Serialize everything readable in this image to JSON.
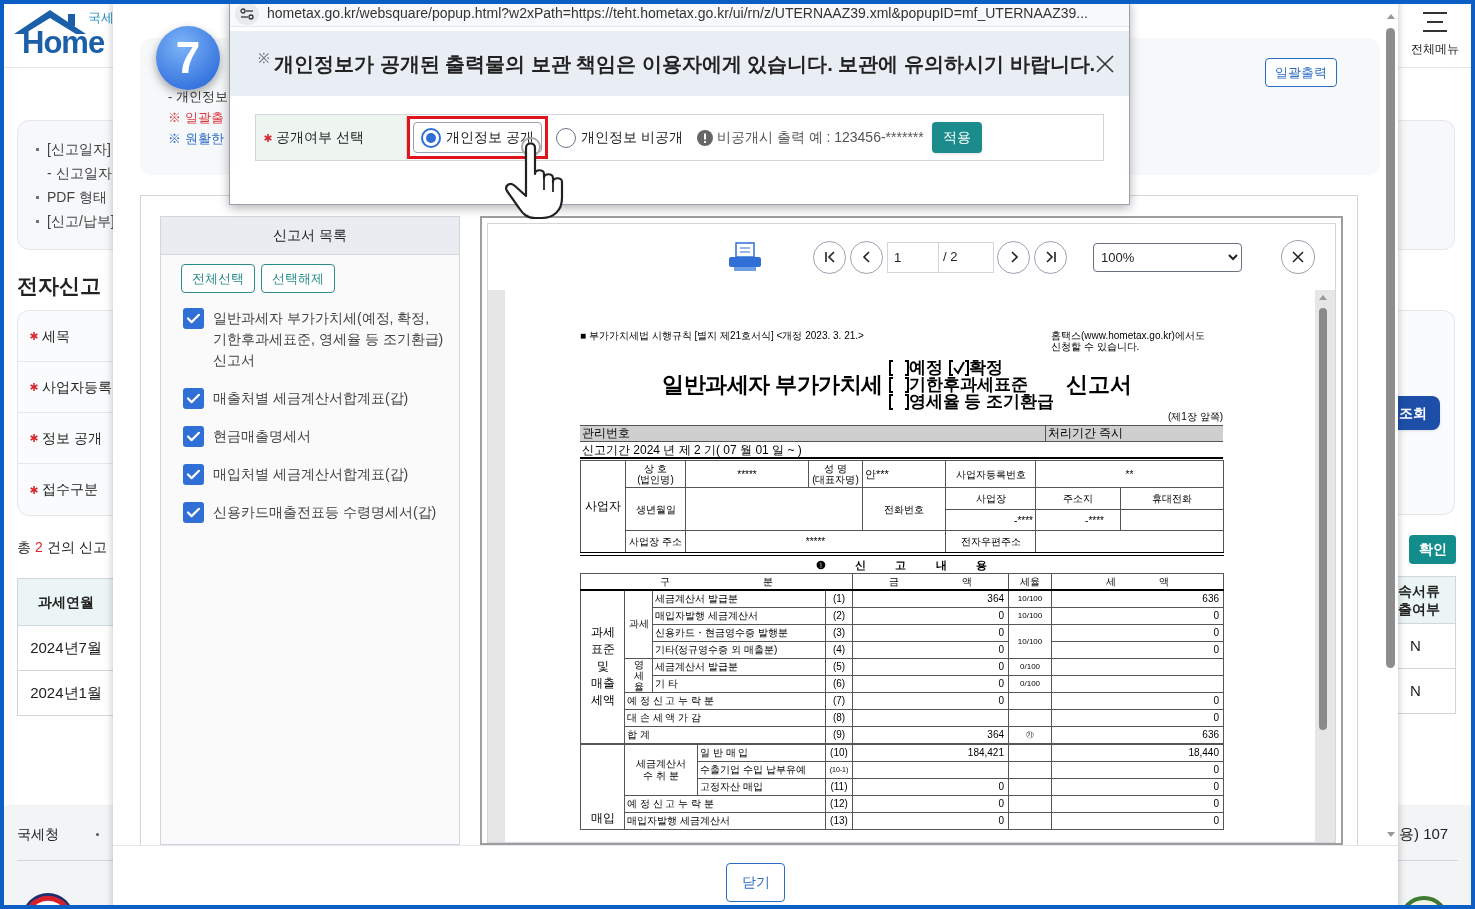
{
  "page": {
    "logo": {
      "label": "국세",
      "wordmark": "Home"
    },
    "menu_label": "전체메뉴",
    "guide_lines": [
      {
        "text": "[신고일자]",
        "bullet": true
      },
      {
        "text": "- 신고일자",
        "bullet": false
      },
      {
        "text": "PDF 형태",
        "bullet": true
      },
      {
        "text": "[신고/납부]",
        "bullet": true
      }
    ],
    "section_title": "전자신고",
    "search_fields": [
      {
        "label": "세목",
        "required": true
      },
      {
        "label": "사업자등록",
        "required": true
      },
      {
        "label": "정보 공개",
        "required": true
      },
      {
        "label": "접수구분",
        "required": true
      }
    ],
    "search_button": "조회",
    "result_count": {
      "prefix": "총",
      "count": "2",
      "suffix": "건의 신고"
    },
    "confirm_button": "확인",
    "table": {
      "column_1": "과세연월",
      "column_2": "속서류\n출여부",
      "rows": [
        {
          "column_1": "2024년7월",
          "column_2": "N"
        },
        {
          "column_1": "2024년1월",
          "column_2": "N"
        }
      ]
    },
    "footer": {
      "left": "국세청",
      "right": "용) 107"
    }
  },
  "modal": {
    "step_badge": "7",
    "notes": [
      {
        "text": "- 개인정보",
        "color": "#333333"
      },
      {
        "text": "※ 일괄출",
        "color": "#d9363e"
      },
      {
        "text": "※ 원활한",
        "color": "#2b6cc4"
      }
    ],
    "bulk_print_button": "일괄출력",
    "report_list": {
      "title": "신고서 목록",
      "buttons": [
        "전체선택",
        "선택해제"
      ],
      "items": [
        {
          "label": "일반과세자 부가가치세(예정, 확정, 기한후과세표준, 영세율 등 조기환급)신고서",
          "checked": true
        },
        {
          "label": "매출처별 세금계산서합계표(갑)",
          "checked": true
        },
        {
          "label": "현금매출명세서",
          "checked": true
        },
        {
          "label": "매입처별 세금계산서합계표(갑)",
          "checked": true
        },
        {
          "label": "신용카드매출전표등 수령명세서(갑)",
          "checked": true
        }
      ]
    },
    "viewer": {
      "page": "1",
      "page_total": "/ 2",
      "zoom": "100%",
      "document": {
        "form_note": "■ 부가가치세법 시행규칙 [별지 제21호서식] <개정 2023. 3. 21.>",
        "online_note": "홈택스(www.hometax.go.kr)에서도\n신청할 수 있습니다.",
        "title": "일반과세자 부가가치세",
        "title_options": [
          [
            {
              "label": "예정",
              "checked": false
            },
            {
              "label": "확정",
              "checked": true
            }
          ],
          [
            {
              "label": "기한후과세표준",
              "checked": false
            }
          ],
          [
            {
              "label": "영세율 등 조기환급",
              "checked": false
            }
          ]
        ],
        "title_suffix": "신고서",
        "page_note": "(제1장 앞쪽)",
        "management_label": "관리번호",
        "processing": "처리기간 즉시",
        "period": "신고기간 2024 년 제 2 기( 07 월 01 일 ~ )",
        "business": {
          "label": "사업자",
          "trade_name_label": "상 호\n(법인명)",
          "trade_name": "*****",
          "representative_label": "성 명\n(대표자명)",
          "representative": "안***",
          "registration_label": "사업자등록번호",
          "registration_number": "**",
          "birth_label": "생년월일",
          "phone_label": "전화번호",
          "phone_columns": [
            "사업장",
            "주소지",
            "휴대전화"
          ],
          "phones": [
            "-****",
            "-****"
          ],
          "address_label": "사업장 주소",
          "address": "*****",
          "email_label": "전자우편주소"
        },
        "section_heading": "❶ 신 고 내 용",
        "columns": [
          "구 분",
          "금 액",
          "세율",
          "세 액"
        ],
        "sections": [
          {
            "lines": [
              "과세",
              "표준",
              "및",
              "매출",
              "세액"
            ],
            "groups": [
              {
                "label": "과세",
                "vertical": false,
                "rows": [
                  {
                    "item": "세금계산서 발급분",
                    "no": "(1)",
                    "amount": "364",
                    "rate": "10/100",
                    "tax": "636"
                  },
                  {
                    "item": "매입자발행 세금계산서",
                    "no": "(2)",
                    "amount": "0",
                    "rate": "10/100",
                    "tax": "0"
                  },
                  {
                    "item": "신용카드・현금영수증 발행분",
                    "no": "(3)",
                    "amount": "0",
                    "rate": "10/100",
                    "tax": "0"
                  },
                  {
                    "item": "기타(정규영수증 외 매출분)",
                    "no": "(4)",
                    "amount": "0",
                    "rate_merged": true,
                    "tax": "0"
                  }
                ]
              },
              {
                "label": "영세율",
                "vertical": true,
                "rows": [
                  {
                    "item": "세금계산서 발급분",
                    "no": "(5)",
                    "amount": "0",
                    "rate": "0/100"
                  },
                  {
                    "item": "기 타",
                    "no": "(6)",
                    "amount": "0",
                    "rate": "0/100"
                  }
                ]
              },
              {
                "rows": [
                  {
                    "item": "예 정 신 고 누 락 분",
                    "no": "(7)",
                    "amount": "0",
                    "tax": "0"
                  },
                  {
                    "item": "대 손 세 액 가 감",
                    "no": "(8)",
                    "tax": "0"
                  },
                  {
                    "item": "합 계",
                    "no": "(9)",
                    "amount": "364",
                    "rate": "㉮",
                    "tax": "636"
                  }
                ]
              }
            ]
          },
          {
            "lines": [
              "매입"
            ],
            "groups": [
              {
                "label": "세금계산서\n수 취 분",
                "vertical": false,
                "rows": [
                  {
                    "item": "일 반 매 입",
                    "no": "(10)",
                    "amount": "184,421",
                    "tax": "18,440"
                  },
                  {
                    "item": "수출기업 수입 납부유예",
                    "no": "(10-1)",
                    "tax": "0"
                  },
                  {
                    "item": "고정자산 매입",
                    "no": "(11)",
                    "amount": "0",
                    "tax": "0"
                  }
                ]
              },
              {
                "rows": [
                  {
                    "item": "예 정 신 고 누 락 분",
                    "no": "(12)",
                    "amount": "0",
                    "tax": "0"
                  },
                  {
                    "item": "매입자발행 세금계산서",
                    "no": "(13)",
                    "amount": "0",
                    "tax": "0"
                  }
                ]
              }
            ]
          }
        ]
      }
    },
    "close_button": "닫기"
  },
  "popup": {
    "url": "hometax.go.kr/websquare/popup.html?w2xPath=https://teht.hometax.go.kr/ui/rn/z/UTERNAAZ39.xml&popupID=mf_UTERNAAZ39...",
    "notice_mark": "※",
    "notice": "개인정보가 공개된 출력물의 보관 책임은 이용자에게 있습니다. 보관에 유의하시기 바랍니다.",
    "field_label": "공개여부 선택",
    "field_required": true,
    "options": [
      {
        "label": "개인정보 공개",
        "selected": true,
        "highlighted": true
      },
      {
        "label": "개인정보 비공개",
        "selected": false,
        "highlighted": false
      }
    ],
    "hint": "비공개시 출력 예 : 123456-*******",
    "apply_button": "적용"
  }
}
